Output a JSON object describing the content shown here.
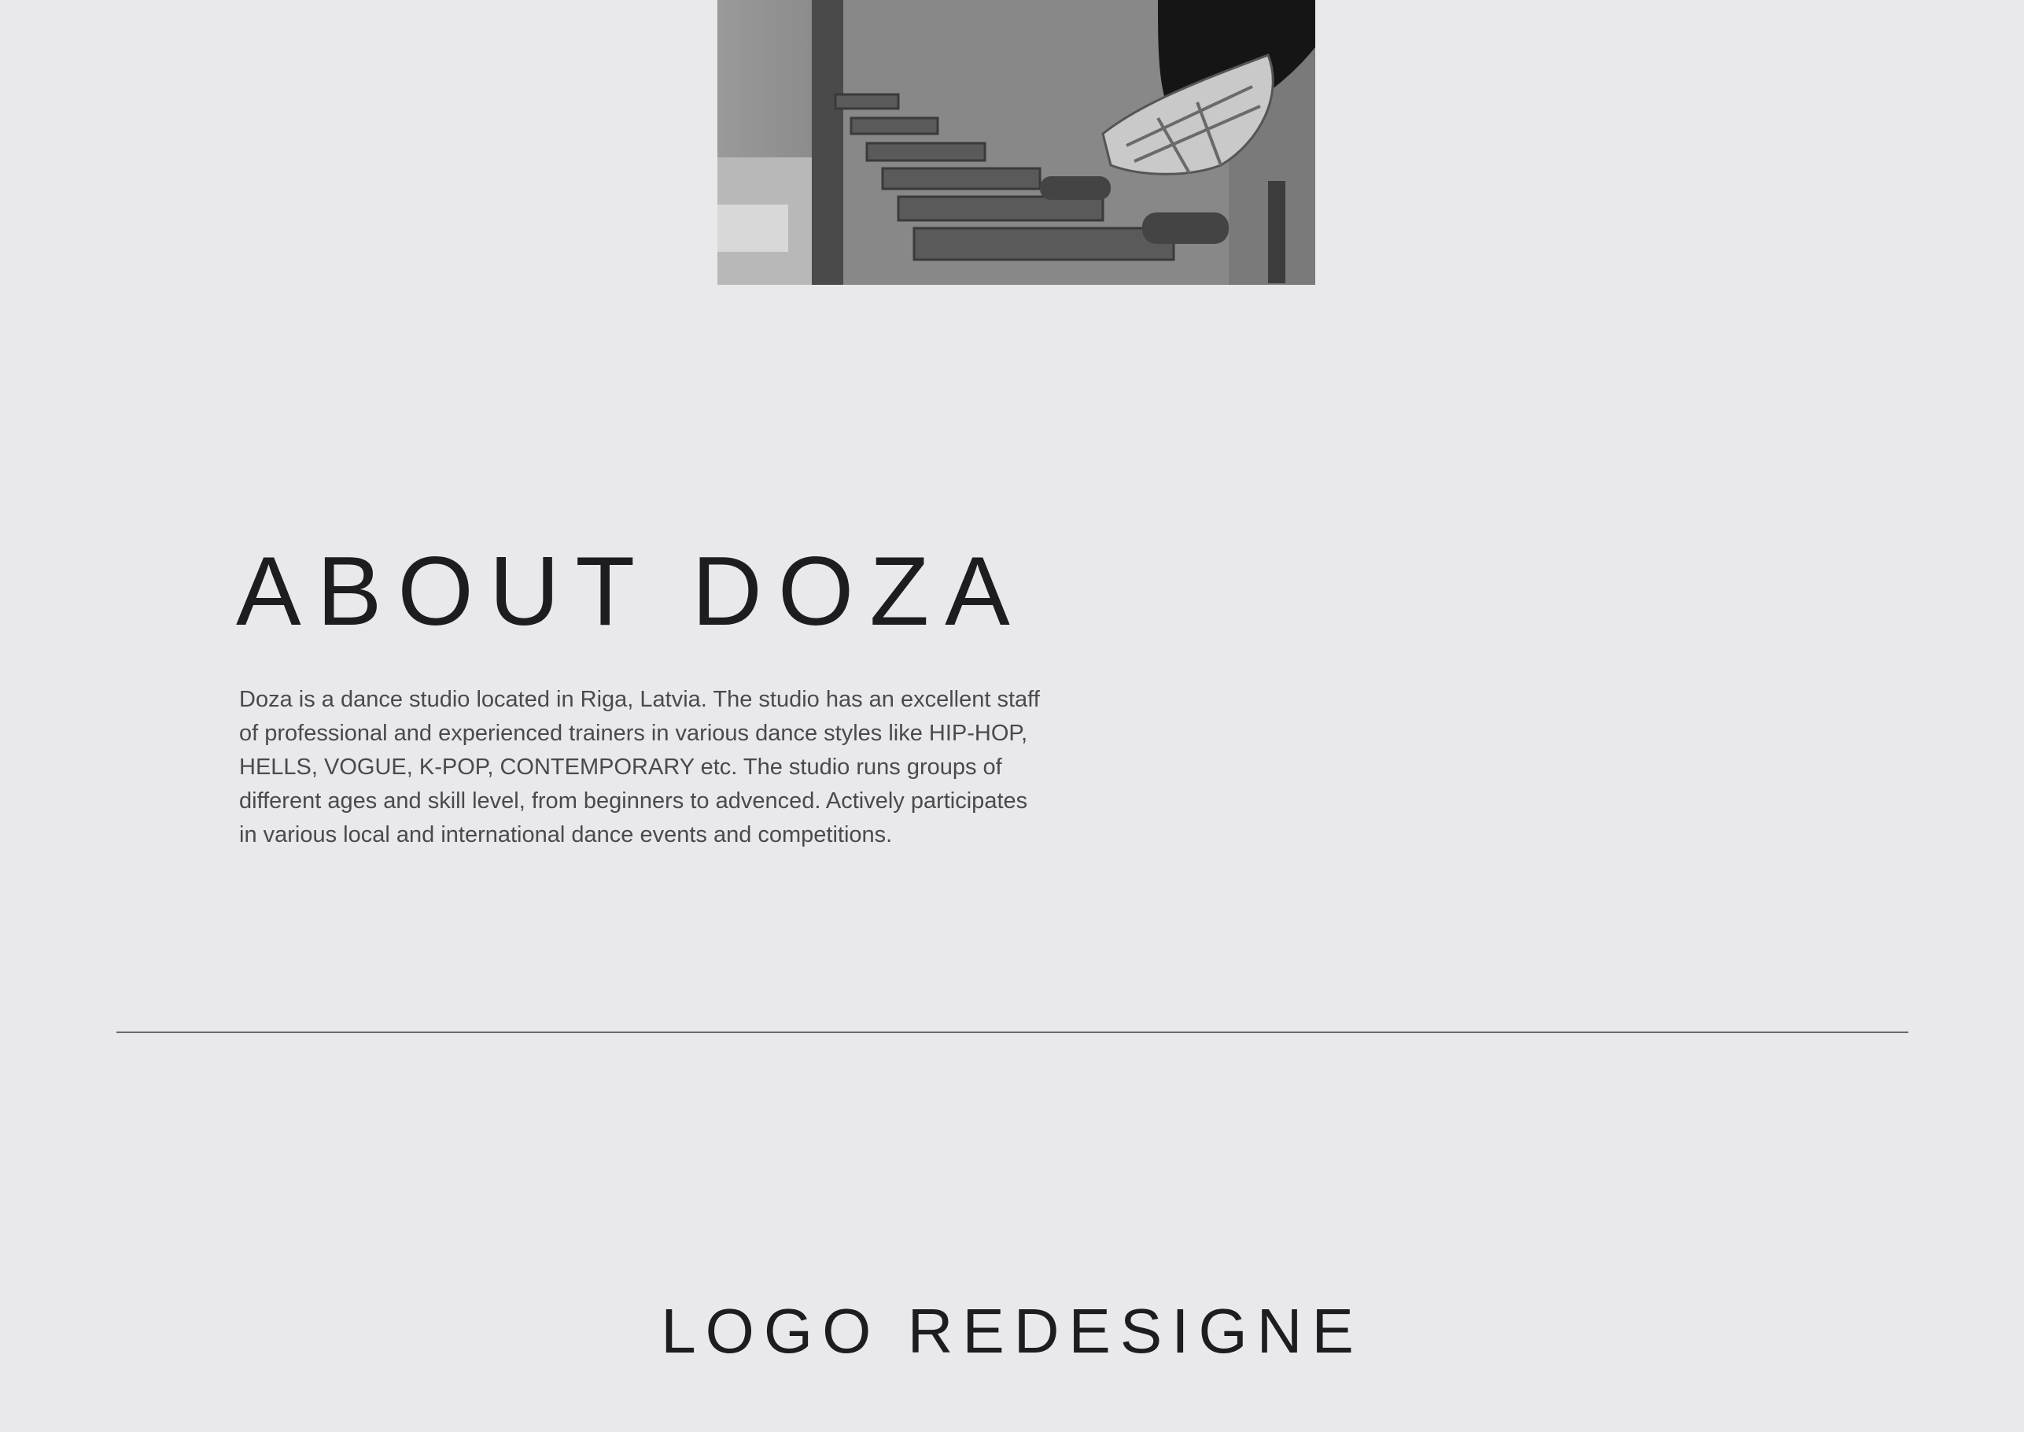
{
  "about": {
    "title": "ABOUT DOZA",
    "lines": [
      "Doza is a dance studio located in Riga, Latvia. The studio has an excellent staff",
      "of professional and experienced trainers in various dance styles like HIP-HOP,",
      "HELLS, VOGUE, K-POP, CONTEMPORARY etc. The studio runs groups of",
      "different ages and skill level, from beginners to advenced. Actively participates",
      "in various local and international dance events and competitions."
    ]
  },
  "logo_section": {
    "title": "LOGO REDESIGNE"
  },
  "colors": {
    "background": "#e9e9eb",
    "text": "#1d1d1f",
    "body_text": "#4a4a4c",
    "divider": "#6a6a6c"
  }
}
